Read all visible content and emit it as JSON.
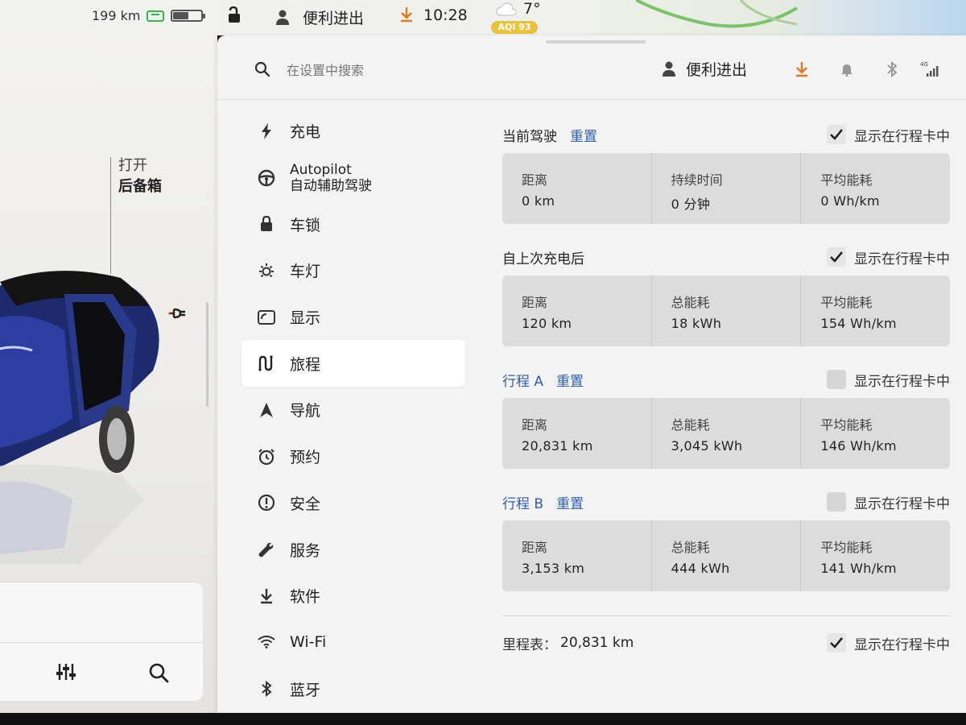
{
  "car_panel": {
    "range": "199 km",
    "battery_level": 0.55,
    "trunk": {
      "action": "打开",
      "target": "后备箱"
    }
  },
  "status_bar": {
    "profile": "便利进出",
    "time": "10:28",
    "temperature": "7°",
    "aqi": "AQI 93",
    "icons": [
      "lock-open-icon",
      "person-icon",
      "download-icon",
      "cloud-icon"
    ]
  },
  "settings": {
    "search_placeholder": "在设置中搜索",
    "header": {
      "profile": "便利进出",
      "icons": [
        "person-icon",
        "download-icon",
        "bell-icon",
        "bluetooth-icon",
        "signal-4g-icon"
      ],
      "network": "4G"
    },
    "sidebar": {
      "items": [
        {
          "icon": "bolt-icon",
          "label": "充电"
        },
        {
          "icon": "steering-wheel-icon",
          "label": "Autopilot",
          "sub": "自动辅助驾驶"
        },
        {
          "icon": "lock-icon",
          "label": "车锁"
        },
        {
          "icon": "light-icon",
          "label": "车灯"
        },
        {
          "icon": "display-icon",
          "label": "显示"
        },
        {
          "icon": "trip-icon",
          "label": "旅程",
          "active": true
        },
        {
          "icon": "navigation-icon",
          "label": "导航"
        },
        {
          "icon": "alarm-icon",
          "label": "预约"
        },
        {
          "icon": "alert-icon",
          "label": "安全"
        },
        {
          "icon": "wrench-icon",
          "label": "服务"
        },
        {
          "icon": "download-icon",
          "label": "软件"
        },
        {
          "icon": "wifi-icon",
          "label": "Wi-Fi"
        },
        {
          "icon": "bluetooth-icon",
          "label": "蓝牙"
        }
      ]
    },
    "sections": [
      {
        "title": "当前驾驶",
        "reset": "重置",
        "show_label": "显示在行程卡中",
        "checked": true,
        "stats": [
          {
            "label": "距离",
            "value": "0 km"
          },
          {
            "label": "持续时间",
            "value": "0 分钟"
          },
          {
            "label": "平均能耗",
            "value": "0 Wh/km"
          }
        ]
      },
      {
        "title": "自上次充电后",
        "reset": "",
        "show_label": "显示在行程卡中",
        "checked": true,
        "stats": [
          {
            "label": "距离",
            "value": "120 km"
          },
          {
            "label": "总能耗",
            "value": "18 kWh"
          },
          {
            "label": "平均能耗",
            "value": "154 Wh/km"
          }
        ]
      },
      {
        "title": "行程 A",
        "reset": "重置",
        "show_label": "显示在行程卡中",
        "checked": false,
        "stats": [
          {
            "label": "距离",
            "value": "20,831 km"
          },
          {
            "label": "总能耗",
            "value": "3,045 kWh"
          },
          {
            "label": "平均能耗",
            "value": "146 Wh/km"
          }
        ]
      },
      {
        "title": "行程 B",
        "reset": "重置",
        "show_label": "显示在行程卡中",
        "checked": false,
        "stats": [
          {
            "label": "距离",
            "value": "3,153 km"
          },
          {
            "label": "总能耗",
            "value": "444 kWh"
          },
          {
            "label": "平均能耗",
            "value": "141 Wh/km"
          }
        ]
      }
    ],
    "odometer": {
      "label": "里程表：",
      "value": "20,831 km",
      "show_label": "显示在行程卡中",
      "checked": true
    }
  },
  "colors": {
    "accent": "#2f5fb3",
    "download": "#e07a1f",
    "charge": "#3bb54a",
    "aqi": "#e8c33c"
  }
}
